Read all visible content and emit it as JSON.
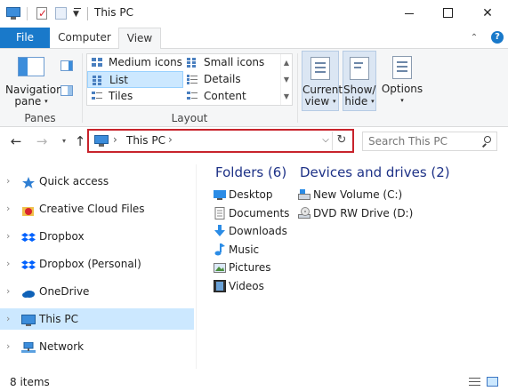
{
  "window": {
    "title": "This PC",
    "min_icon": "minimize-icon",
    "max_icon": "maximize-icon",
    "close_icon": "close-icon",
    "close_glyph": "✕"
  },
  "ribbon_tabs": [
    {
      "label": "File",
      "active": false
    },
    {
      "label": "Computer",
      "active": false
    },
    {
      "label": "View",
      "active": true
    }
  ],
  "help_glyph": "?",
  "ribbon": {
    "panes": {
      "group_label": "Panes",
      "navigation_pane_line1": "Navigation",
      "navigation_pane_line2": "pane",
      "caret": "▾"
    },
    "layout": {
      "group_label": "Layout",
      "items": [
        {
          "label": "Medium icons",
          "selected": false
        },
        {
          "label": "Small icons",
          "selected": false
        },
        {
          "label": "List",
          "selected": true
        },
        {
          "label": "Details",
          "selected": false
        },
        {
          "label": "Tiles",
          "selected": false
        },
        {
          "label": "Content",
          "selected": false
        }
      ]
    },
    "current_view": {
      "line1": "Current",
      "line2": "view"
    },
    "show_hide": {
      "line1": "Show/",
      "line2": "hide"
    },
    "options": {
      "line1": "Options"
    }
  },
  "address": {
    "location": "This PC",
    "chevron": "›",
    "refresh_glyph": "↻",
    "dropdown_glyph": "⌵"
  },
  "nav_buttons": {
    "back": "←",
    "forward": "→",
    "recent": "▾",
    "up": "↑"
  },
  "search": {
    "placeholder": "Search This PC"
  },
  "nav_pane": {
    "items": [
      {
        "label": "Quick access",
        "icon": "star-icon",
        "selected": false
      },
      {
        "label": "Creative Cloud Files",
        "icon": "creative-cloud-icon",
        "selected": false
      },
      {
        "label": "Dropbox",
        "icon": "dropbox-icon",
        "selected": false
      },
      {
        "label": "Dropbox (Personal)",
        "icon": "dropbox-icon",
        "selected": false
      },
      {
        "label": "OneDrive",
        "icon": "onedrive-icon",
        "selected": false
      },
      {
        "label": "This PC",
        "icon": "computer-icon",
        "selected": true
      },
      {
        "label": "Network",
        "icon": "network-icon",
        "selected": false
      }
    ]
  },
  "content": {
    "folders_header": "Folders (6)",
    "drives_header": "Devices and drives (2)",
    "folders": [
      {
        "label": "Desktop",
        "icon": "desktop-folder-icon"
      },
      {
        "label": "Documents",
        "icon": "documents-folder-icon"
      },
      {
        "label": "Downloads",
        "icon": "downloads-folder-icon"
      },
      {
        "label": "Music",
        "icon": "music-folder-icon"
      },
      {
        "label": "Pictures",
        "icon": "pictures-folder-icon"
      },
      {
        "label": "Videos",
        "icon": "videos-folder-icon"
      }
    ],
    "drives": [
      {
        "label": "New Volume (C:)",
        "icon": "hard-drive-icon"
      },
      {
        "label": "DVD RW Drive (D:)",
        "icon": "dvd-drive-icon"
      }
    ]
  },
  "status": {
    "item_count": "8 items"
  },
  "colors": {
    "accent": "#1979ca",
    "selection": "#cce8ff",
    "header_text": "#1e3287",
    "highlight_border": "#c8232c"
  }
}
